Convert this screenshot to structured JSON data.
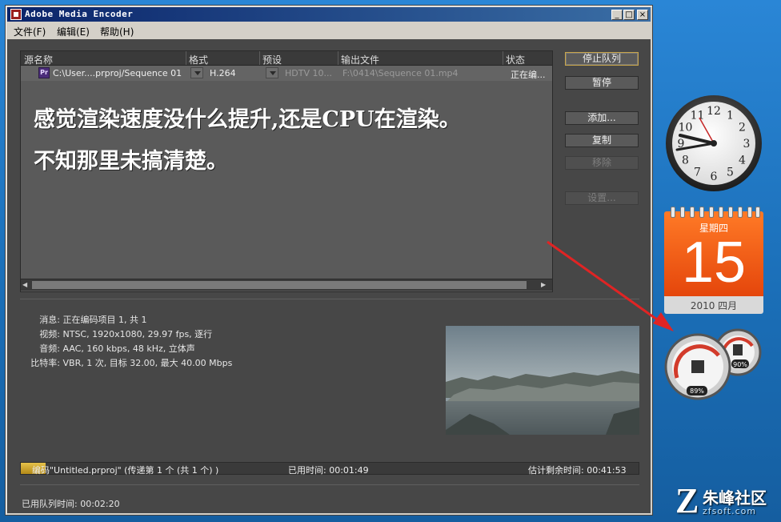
{
  "window": {
    "title": "Adobe Media Encoder",
    "controls": {
      "minimize": "_",
      "maximize": "□",
      "close": "×"
    }
  },
  "menu": [
    {
      "label": "文件(F)"
    },
    {
      "label": "编辑(E)"
    },
    {
      "label": "帮助(H)"
    }
  ],
  "queue": {
    "columns": [
      "源名称",
      "格式",
      "预设",
      "输出文件",
      "状态"
    ],
    "row": {
      "source": "C:\\User....prproj/Sequence 01",
      "format": "H.264",
      "preset": "HDTV 10...",
      "output": "F:\\0414\\Sequence 01.mp4",
      "status": "正在编..."
    },
    "overlay_lines": [
      "感觉渲染速度没什么提升,还是CPU在渲染。",
      "不知那里未搞清楚。"
    ]
  },
  "buttons": {
    "stop": "停止队列",
    "pause": "暂停",
    "add": "添加...",
    "duplicate": "复制",
    "remove": "移除",
    "settings": "设置..."
  },
  "info": {
    "message_label": "消息:",
    "message": "正在编码项目 1, 共 1",
    "video_label": "视频:",
    "video": "NTSC, 1920x1080, 29.97 fps, 逐行",
    "audio_label": "音频:",
    "audio": "AAC, 160 kbps, 48 kHz, 立体声",
    "bitrate_label": "比特率:",
    "bitrate": "VBR, 1 次, 目标 32.00, 最大 40.00 Mbps"
  },
  "progress": {
    "task": "编码\"Untitled.prproj\" (传递第 1 个 (共 1 个) )",
    "elapsed": "已用时间: 00:01:49",
    "remaining": "估计剩余时间: 00:41:53",
    "fraction": 0.04
  },
  "queue_time": "已用队列时间: 00:02:20",
  "gadgets": {
    "clock_numbers": [
      "12",
      "1",
      "2",
      "3",
      "4",
      "5",
      "6",
      "7",
      "8",
      "9",
      "10",
      "11"
    ],
    "calendar": {
      "weekday": "星期四",
      "day": "15",
      "month": "2010 四月"
    },
    "meters": {
      "cpu": "89%",
      "memory": "90%"
    }
  },
  "watermark": {
    "logo": "Z",
    "text": "朱峰社区",
    "url": "zfsoft.com"
  },
  "colors": {
    "accent_arrow": "#e02424",
    "calendar": "#f0561a",
    "progress": "#d4aa30"
  }
}
